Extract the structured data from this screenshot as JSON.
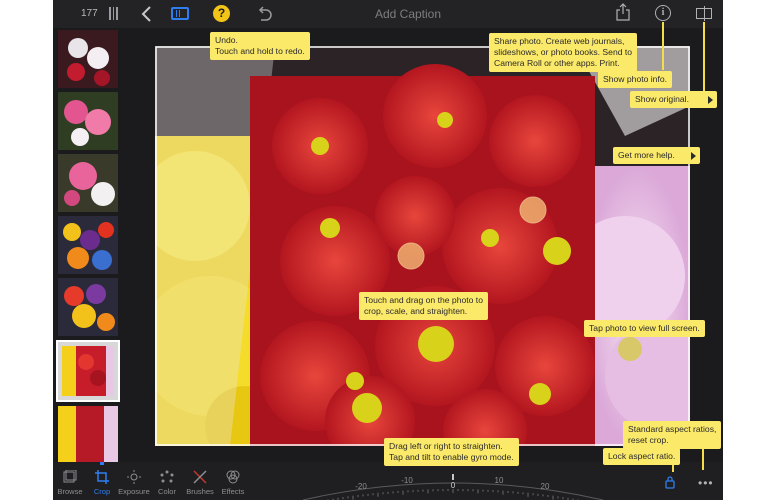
{
  "topbar": {
    "photo_count": "177",
    "caption_placeholder": "Add Caption"
  },
  "tools": [
    {
      "label": "Browse"
    },
    {
      "label": "Crop"
    },
    {
      "label": "Exposure"
    },
    {
      "label": "Color"
    },
    {
      "label": "Brushes"
    },
    {
      "label": "Effects"
    }
  ],
  "tips": {
    "undo": "Undo.\nTouch and hold to redo.",
    "share": "Share photo. Create web journals,\nslideshows, or photo books. Send to\nCamera Roll or other apps. Print.",
    "info": "Show photo info.",
    "original": "Show original.",
    "help": "Get more help.",
    "crop": "Touch and drag on the photo to\ncrop, scale, and straighten.",
    "fullscreen": "Tap photo to view full screen.",
    "aspect": "Standard aspect ratios,\nreset crop.",
    "straighten": "Drag left or right to straighten.\nTap and tilt to enable gyro mode.",
    "lock": "Lock aspect ratio."
  },
  "dial": {
    "labels": [
      "-20",
      "-10",
      "0",
      "10",
      "20"
    ]
  },
  "colors": {
    "accent": "#2f7ef0",
    "tip_background": "#fbe96a",
    "help_button": "#f2c418",
    "background": "#1b1b1d"
  }
}
